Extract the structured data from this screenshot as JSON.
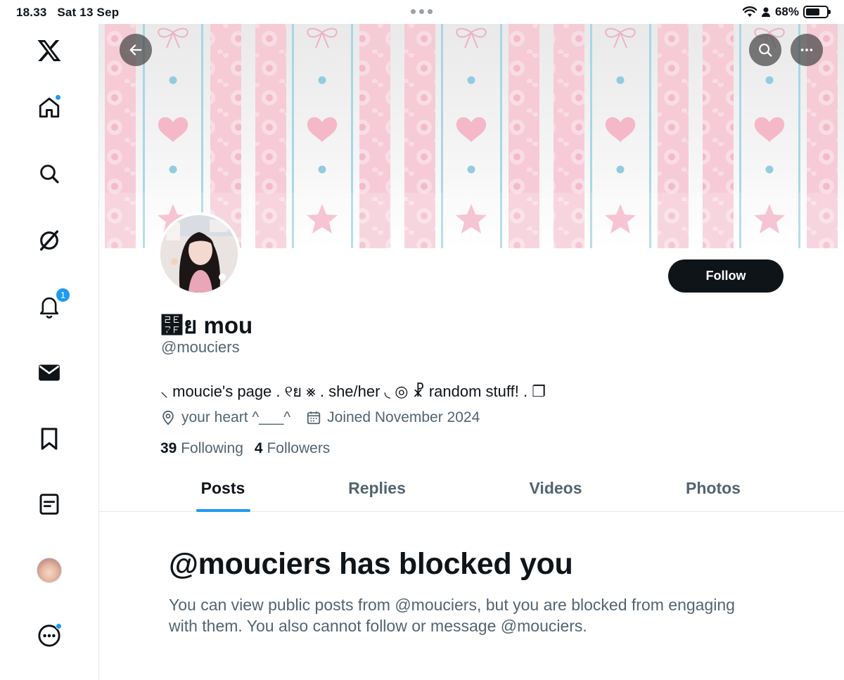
{
  "status_bar": {
    "time": "18.33",
    "date": "Sat 13 Sep",
    "battery": "68%",
    "battery_level": 0.68
  },
  "sidebar": {
    "logo_icon": "x-logo-icon",
    "items": [
      {
        "name": "home",
        "icon": "home-icon",
        "has_dot": true
      },
      {
        "name": "explore",
        "icon": "search-icon"
      },
      {
        "name": "grok",
        "icon": "grok-icon"
      },
      {
        "name": "notifications",
        "icon": "bell-icon",
        "badge": "1"
      },
      {
        "name": "messages",
        "icon": "envelope-icon"
      },
      {
        "name": "bookmarks",
        "icon": "bookmark-icon"
      },
      {
        "name": "lists",
        "icon": "list-icon"
      },
      {
        "name": "profile",
        "icon": "avatar"
      },
      {
        "name": "more",
        "icon": "more-circle-icon",
        "has_dot": true
      }
    ]
  },
  "profile": {
    "display_name": "⹿ย mou",
    "handle": "@mouciers",
    "bio": "⸜ moucie's page  .  ୧ย ⨳  .  she/her ◟ ◎ ☧ random stuff!  .  ❐",
    "location": "your heart ^___^",
    "joined": "Joined November 2024",
    "following_count": "39",
    "following_label": "Following",
    "followers_count": "4",
    "followers_label": "Followers",
    "follow_button": "Follow"
  },
  "tabs": [
    {
      "label": "Posts",
      "active": true
    },
    {
      "label": "Replies",
      "active": false
    },
    {
      "label": "Videos",
      "active": false
    },
    {
      "label": "Photos",
      "active": false
    }
  ],
  "blocked": {
    "title": "@mouciers has blocked you",
    "message": "You can view public posts from @mouciers, but you are blocked from engaging with them. You also cannot follow or message @mouciers."
  },
  "colors": {
    "accent": "#1d9bf0",
    "text_primary": "#0f1419",
    "text_secondary": "#536471",
    "banner_pink": "#f4c7d3",
    "banner_blue": "#a9d6e5"
  }
}
